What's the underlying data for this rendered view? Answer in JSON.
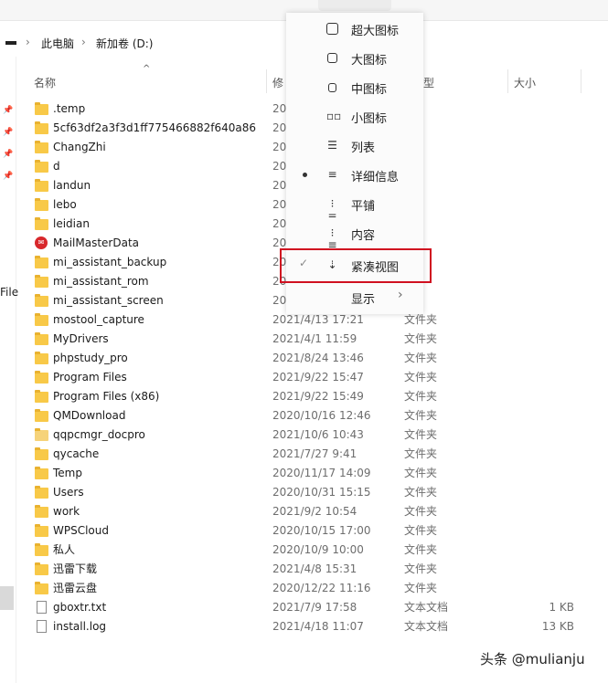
{
  "address": {
    "segments": [
      "此电脑",
      "新加卷 (D:)"
    ],
    "separator": "›"
  },
  "left_cut_label": "File",
  "columns": {
    "name": "名称",
    "modified": "修",
    "type": "型",
    "size": "大小"
  },
  "files": [
    {
      "name": ".temp",
      "date": "20",
      "type": "夹",
      "size": "",
      "icon": "folder"
    },
    {
      "name": "5cf63df2a3f3d1ff775466882f640a86",
      "date": "20",
      "type": "夹",
      "size": "",
      "icon": "folder"
    },
    {
      "name": "ChangZhi",
      "date": "20",
      "type": "夹",
      "size": "",
      "icon": "folder"
    },
    {
      "name": "d",
      "date": "20",
      "type": "夹",
      "size": "",
      "icon": "folder"
    },
    {
      "name": "landun",
      "date": "20",
      "type": "夹",
      "size": "",
      "icon": "folder"
    },
    {
      "name": "lebo",
      "date": "20",
      "type": "夹",
      "size": "",
      "icon": "folder"
    },
    {
      "name": "leidian",
      "date": "20",
      "type": "夹",
      "size": "",
      "icon": "folder"
    },
    {
      "name": "MailMasterData",
      "date": "20",
      "type": "夹",
      "size": "",
      "icon": "mailmaster"
    },
    {
      "name": "mi_assistant_backup",
      "date": "20",
      "type": "夹",
      "size": "",
      "icon": "folder"
    },
    {
      "name": "mi_assistant_rom",
      "date": "20",
      "type": "夹",
      "size": "",
      "icon": "folder"
    },
    {
      "name": "mi_assistant_screen",
      "date": "20",
      "type": "夹",
      "size": "",
      "icon": "folder"
    },
    {
      "name": "mostool_capture",
      "date": "2021/4/13 17:21",
      "type": "文件夹",
      "size": "",
      "icon": "folder"
    },
    {
      "name": "MyDrivers",
      "date": "2021/4/1 11:59",
      "type": "文件夹",
      "size": "",
      "icon": "folder"
    },
    {
      "name": "phpstudy_pro",
      "date": "2021/8/24 13:46",
      "type": "文件夹",
      "size": "",
      "icon": "folder"
    },
    {
      "name": "Program Files",
      "date": "2021/9/22 15:47",
      "type": "文件夹",
      "size": "",
      "icon": "folder"
    },
    {
      "name": "Program Files (x86)",
      "date": "2021/9/22 15:49",
      "type": "文件夹",
      "size": "",
      "icon": "folder"
    },
    {
      "name": "QMDownload",
      "date": "2020/10/16 12:46",
      "type": "文件夹",
      "size": "",
      "icon": "folder"
    },
    {
      "name": "qqpcmgr_docpro",
      "date": "2021/10/6 10:43",
      "type": "文件夹",
      "size": "",
      "icon": "folder-light"
    },
    {
      "name": "qycache",
      "date": "2021/7/27 9:41",
      "type": "文件夹",
      "size": "",
      "icon": "folder"
    },
    {
      "name": "Temp",
      "date": "2020/11/17 14:09",
      "type": "文件夹",
      "size": "",
      "icon": "folder"
    },
    {
      "name": "Users",
      "date": "2020/10/31 15:15",
      "type": "文件夹",
      "size": "",
      "icon": "folder"
    },
    {
      "name": "work",
      "date": "2021/9/2 10:54",
      "type": "文件夹",
      "size": "",
      "icon": "folder"
    },
    {
      "name": "WPSCloud",
      "date": "2020/10/15 17:00",
      "type": "文件夹",
      "size": "",
      "icon": "folder"
    },
    {
      "name": "私人",
      "date": "2020/10/9 10:00",
      "type": "文件夹",
      "size": "",
      "icon": "folder"
    },
    {
      "name": "迅雷下载",
      "date": "2021/4/8 15:31",
      "type": "文件夹",
      "size": "",
      "icon": "folder"
    },
    {
      "name": "迅雷云盘",
      "date": "2020/12/22 11:16",
      "type": "文件夹",
      "size": "",
      "icon": "folder"
    },
    {
      "name": "gboxtr.txt",
      "date": "2021/7/9 17:58",
      "type": "文本文档",
      "size": "1 KB",
      "icon": "text-file"
    },
    {
      "name": "install.log",
      "date": "2021/4/18 11:07",
      "type": "文本文档",
      "size": "13 KB",
      "icon": "text-file"
    }
  ],
  "view_menu": {
    "items": [
      {
        "label": "超大图标",
        "icon": "extra-large-icons-icon",
        "selected": false,
        "checked": false
      },
      {
        "label": "大图标",
        "icon": "large-icons-icon",
        "selected": false,
        "checked": false
      },
      {
        "label": "中图标",
        "icon": "medium-icons-icon",
        "selected": false,
        "checked": false
      },
      {
        "label": "小图标",
        "icon": "small-icons-icon",
        "selected": false,
        "checked": false
      },
      {
        "label": "列表",
        "icon": "list-icon",
        "selected": false,
        "checked": false
      },
      {
        "label": "详细信息",
        "icon": "details-icon",
        "selected": true,
        "checked": false
      },
      {
        "label": "平铺",
        "icon": "tiles-icon",
        "selected": false,
        "checked": false
      },
      {
        "label": "内容",
        "icon": "content-icon",
        "selected": false,
        "checked": false
      },
      {
        "label": "紧凑视图",
        "icon": "compact-view-icon",
        "selected": false,
        "checked": true
      },
      {
        "label": "显示",
        "icon": "",
        "selected": false,
        "checked": false,
        "submenu": true
      }
    ]
  },
  "watermark": "头条 @mulianju",
  "colors": {
    "highlight_box": "#d01020",
    "folder": "#f8c948",
    "mail_icon": "#d8282c"
  }
}
